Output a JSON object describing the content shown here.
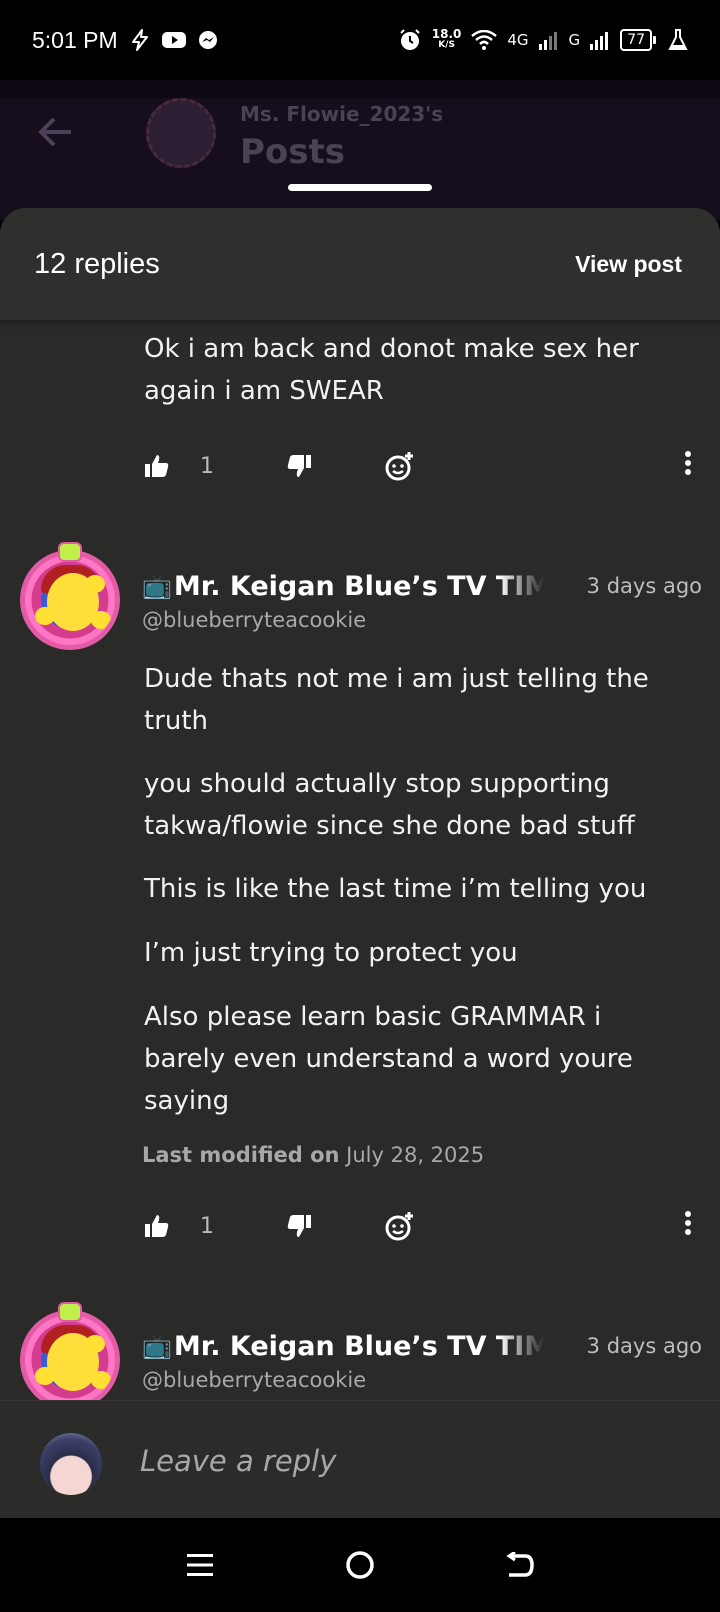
{
  "status_bar": {
    "time": "5:01 PM",
    "net_speed_value": "18.0",
    "net_speed_unit": "K/S",
    "network_4g": "4G",
    "network_g": "G",
    "battery": "77"
  },
  "background_page": {
    "owner_label": "Ms. Flowie_2023's",
    "title": "Posts"
  },
  "sheet": {
    "replies_count": "12 replies",
    "view_post_label": "View post"
  },
  "comments": [
    {
      "paragraphs": [
        "Ok i am back and donot make sex her again i am SWEAR"
      ],
      "likes": "1"
    },
    {
      "author_emoji": "📺",
      "author": "Mr. Keigan Blue’s TV TIME",
      "time_ago": "3 days ago",
      "handle": "@blueberryteacookie",
      "paragraphs": [
        "Dude thats not me i am just telling the truth",
        "you should actually stop supporting takwa/flowie since she done bad stuff",
        "This is like the last time i’m telling you",
        "I’m just trying to protect you",
        "Also please learn basic GRAMMAR i barely even understand a word youre saying"
      ],
      "modified_label": "Last modified on",
      "modified_date": "July 28, 2025",
      "likes": "1"
    },
    {
      "author_emoji": "📺",
      "author": "Mr. Keigan Blue’s TV TIME",
      "time_ago": "3 days ago",
      "handle": "@blueberryteacookie"
    }
  ],
  "reply_bar": {
    "placeholder": "Leave a reply"
  },
  "icons": {
    "like": "thumbs-up-icon",
    "dislike": "thumbs-down-icon",
    "react": "add-reaction-icon",
    "more": "more-vertical-icon"
  }
}
